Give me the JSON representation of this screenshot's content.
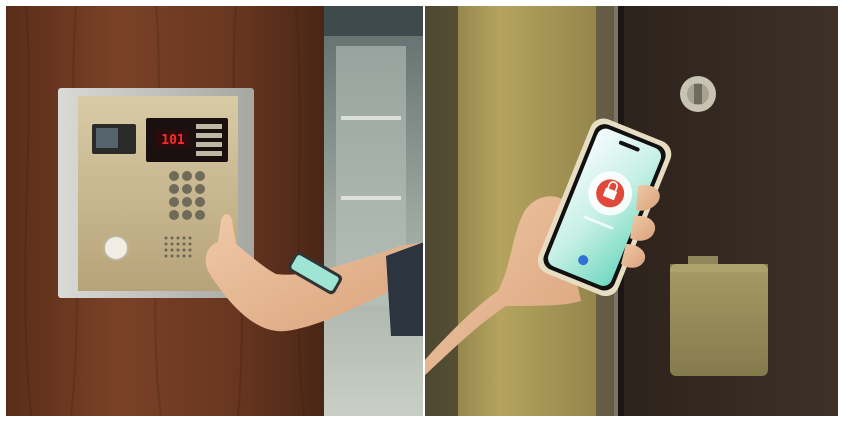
{
  "photo": {
    "left_scene": {
      "intercom_display": "101"
    }
  },
  "colors": {
    "wood_wall": "#6b3a22",
    "panel_metal": "#c8b790",
    "phone_screen": "#7fe3c4",
    "app_accent": "#e0483b",
    "right_wall": "#b5a45f",
    "door": "#3b2e24"
  },
  "icons": [
    "intercom-panel-icon",
    "keypad-icon",
    "smartphone-icon",
    "unlock-app-icon",
    "door-lock-icon"
  ]
}
